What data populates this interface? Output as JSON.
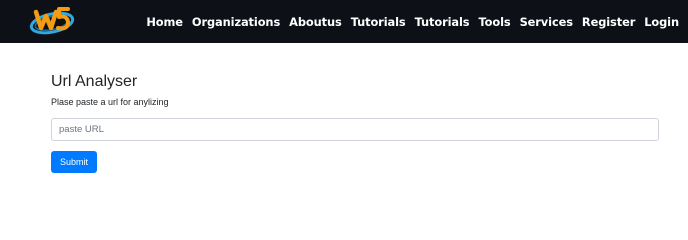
{
  "nav": {
    "logo_icon": "w3-logo-icon",
    "items": [
      {
        "label": "Home"
      },
      {
        "label": "Organizations"
      },
      {
        "label": "Aboutus"
      },
      {
        "label": "Tutorials"
      },
      {
        "label": "Tutorials"
      },
      {
        "label": "Tools"
      },
      {
        "label": "Services"
      },
      {
        "label": "Register"
      },
      {
        "label": "Login"
      }
    ]
  },
  "main": {
    "title": "Url Analyser",
    "subtitle": "Plase paste a url for anylizing",
    "url_input": {
      "placeholder": "paste URL",
      "value": ""
    },
    "submit_label": "Submit"
  },
  "colors": {
    "navbar_bg": "#0d1117",
    "accent": "#007bff",
    "logo_orange": "#f39c12",
    "logo_blue": "#2fa8e0"
  }
}
